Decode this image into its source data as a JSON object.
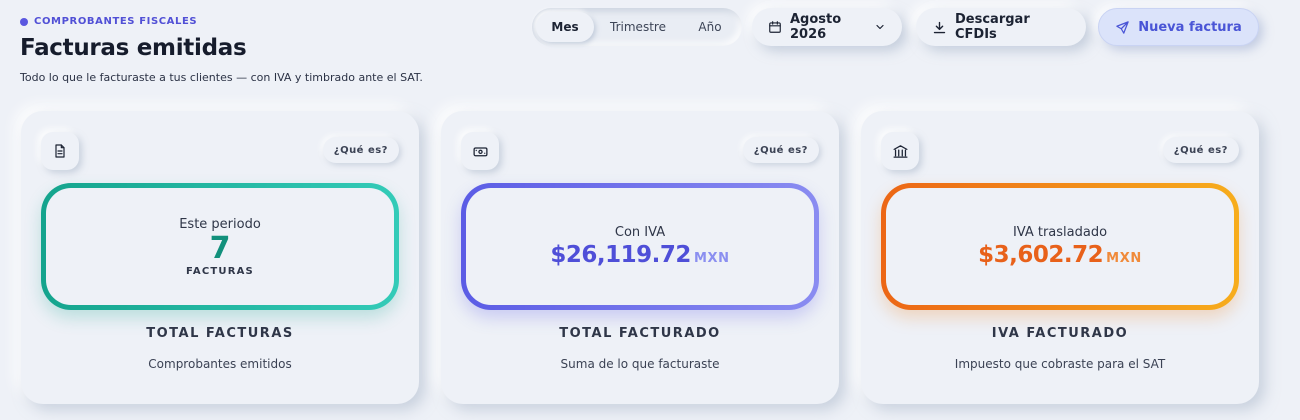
{
  "header": {
    "eyebrow": "COMPROBANTES FISCALES",
    "title": "Facturas emitidas",
    "subtitle": "Todo lo que le facturaste a tus clientes — con IVA y timbrado ante el SAT."
  },
  "period_toggle": {
    "options": [
      "Mes",
      "Trimestre",
      "Año"
    ],
    "selected": "Mes"
  },
  "toolbar": {
    "date_label": "Agosto 2026",
    "download_label": "Descargar CFDIs",
    "new_invoice_label": "Nueva factura"
  },
  "cards": [
    {
      "icon": "document-icon",
      "help_label": "¿Qué es?",
      "metric_label": "Este periodo",
      "metric_value": "7",
      "metric_unit": "FACTURAS",
      "title": "TOTAL FACTURAS",
      "description": "Comprobantes emitidos",
      "accent": "#14a48d"
    },
    {
      "icon": "cash-icon",
      "help_label": "¿Qué es?",
      "metric_label": "Con IVA",
      "metric_value": "$26,119.72",
      "metric_unit": "MXN",
      "title": "TOTAL FACTURADO",
      "description": "Suma de lo que facturaste",
      "accent": "#5b5ce5"
    },
    {
      "icon": "bank-icon",
      "help_label": "¿Qué es?",
      "metric_label": "IVA trasladado",
      "metric_value": "$3,602.72",
      "metric_unit": "MXN",
      "title": "IVA FACTURADO",
      "description": "Impuesto que cobraste para el SAT",
      "accent": "#ec6615"
    }
  ]
}
